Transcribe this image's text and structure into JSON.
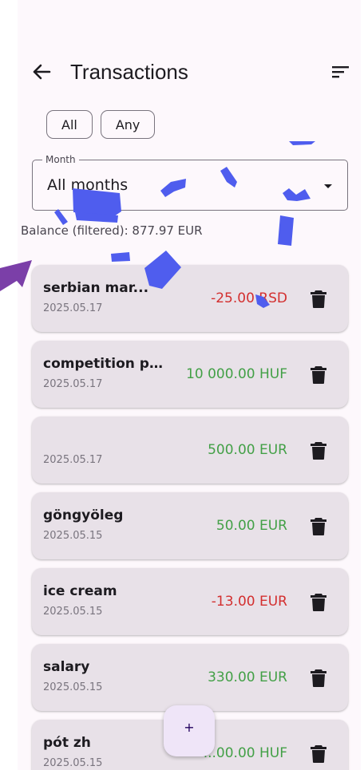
{
  "header": {
    "title": "Transactions",
    "back_icon": "arrow-back-icon",
    "sort_icon": "sort-icon"
  },
  "filters": {
    "chips": [
      "All",
      "Any"
    ]
  },
  "month_field": {
    "label": "Month",
    "value": "All months"
  },
  "balance": "Balance (filtered): 877.97 EUR",
  "colors": {
    "negative": "#d32f2f",
    "positive": "#43a047",
    "annotation_stroke": "#4f5dee",
    "annotation_arrow": "#7b3fa8"
  },
  "transactions": [
    {
      "title": "serbian mar...",
      "date": "2025.05.17",
      "amount": "-25.00 RSD",
      "sign": "negative"
    },
    {
      "title": "competition p...",
      "date": "2025.05.17",
      "amount": "10 000.00 HUF",
      "sign": "positive"
    },
    {
      "title": "",
      "date": "2025.05.17",
      "amount": "500.00 EUR",
      "sign": "positive"
    },
    {
      "title": "göngyöleg",
      "date": "2025.05.15",
      "amount": "50.00 EUR",
      "sign": "positive"
    },
    {
      "title": "ice cream",
      "date": "2025.05.15",
      "amount": "-13.00 EUR",
      "sign": "negative"
    },
    {
      "title": "salary",
      "date": "2025.05.15",
      "amount": "330.00 EUR",
      "sign": "positive"
    },
    {
      "title": "pót zh",
      "date": "2025.05.15",
      "amount": "...00.00 HUF",
      "sign": "positive"
    }
  ],
  "fab": {
    "label": "+"
  }
}
